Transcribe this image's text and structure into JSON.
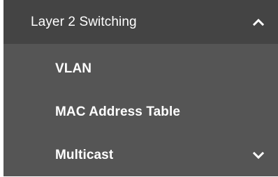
{
  "menu": {
    "section_title": "Layer 2 Switching",
    "section_icon": "chevron-up-icon",
    "items": [
      {
        "label": "VLAN"
      },
      {
        "label": "MAC Address Table"
      },
      {
        "label": "Multicast",
        "icon": "chevron-down-icon"
      }
    ]
  },
  "colors": {
    "header_bg": "#444444",
    "submenu_bg": "#555555",
    "text": "#ffffff"
  }
}
